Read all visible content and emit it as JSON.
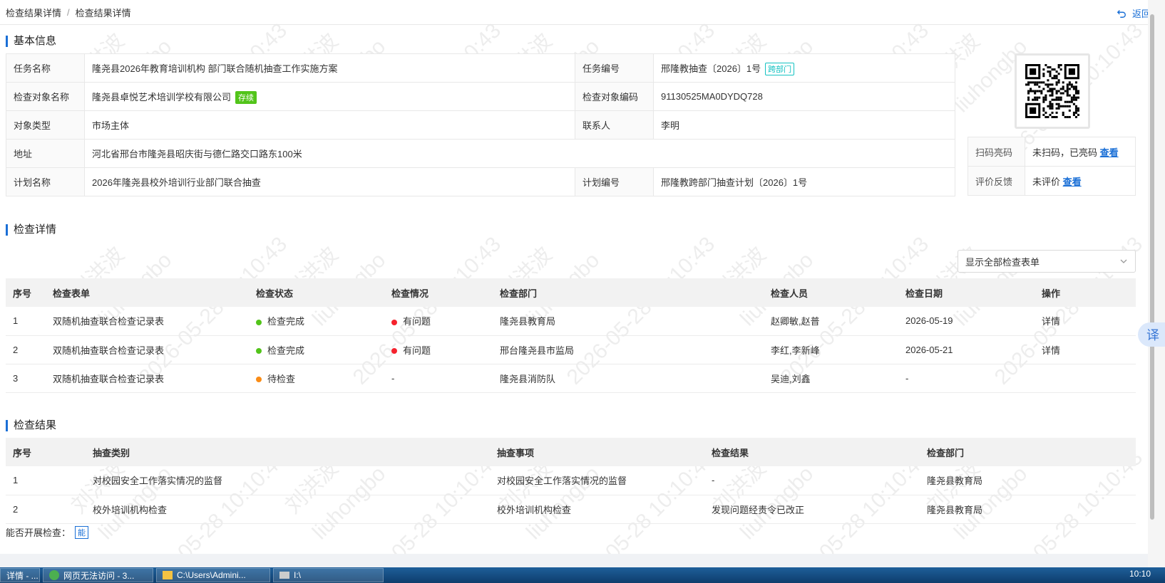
{
  "breadcrumb": {
    "items": [
      "检查结果详情",
      "检查结果详情"
    ],
    "separator": "/"
  },
  "back_label": "返回",
  "sections": {
    "basic": "基本信息",
    "detail": "检查详情",
    "result": "检查结果"
  },
  "basic_info": {
    "task_name_label": "任务名称",
    "task_name": "隆尧县2026年教育培训机构 部门联合随机抽查工作实施方案",
    "task_no_label": "任务编号",
    "task_no": "邢隆教抽查〔2026〕1号",
    "task_no_tag": "跨部门",
    "target_name_label": "检查对象名称",
    "target_name": "隆尧县卓悦艺术培训学校有限公司",
    "target_tag": "存续",
    "target_code_label": "检查对象编码",
    "target_code": "91130525MA0DYDQ728",
    "type_label": "对象类型",
    "type": "市场主体",
    "contact_label": "联系人",
    "contact": "李明",
    "address_label": "地址",
    "address": "河北省邢台市隆尧县昭庆街与德仁路交口路东100米",
    "plan_name_label": "计划名称",
    "plan_name": "2026年隆尧县校外培训行业部门联合抽查",
    "plan_no_label": "计划编号",
    "plan_no": "邢隆教跨部门抽查计划〔2026〕1号"
  },
  "side": {
    "scan_label": "扫码亮码",
    "scan_value": "未扫码，已亮码",
    "scan_link": "查看",
    "feedback_label": "评价反馈",
    "feedback_value": "未评价",
    "feedback_link": "查看"
  },
  "filter_select": "显示全部检查表单",
  "detail_table": {
    "headers": [
      "序号",
      "检查表单",
      "检查状态",
      "检查情况",
      "检查部门",
      "检查人员",
      "检查日期",
      "操作"
    ],
    "rows": [
      {
        "no": "1",
        "form": "双随机抽查联合检查记录表",
        "status": "检查完成",
        "situation": "有问题",
        "dept": "隆尧县教育局",
        "staff": "赵卿敏,赵普",
        "date": "2026-05-19",
        "action": "详情"
      },
      {
        "no": "2",
        "form": "双随机抽查联合检查记录表",
        "status": "检查完成",
        "situation": "有问题",
        "dept": "邢台隆尧县市监局",
        "staff": "李红,李新峰",
        "date": "2026-05-21",
        "action": "详情"
      },
      {
        "no": "3",
        "form": "双随机抽查联合检查记录表",
        "status": "待检查",
        "situation": "-",
        "dept": "隆尧县消防队",
        "staff": "吴迪,刘鑫",
        "date": "-",
        "action": ""
      }
    ]
  },
  "result_table": {
    "headers": [
      "序号",
      "抽查类别",
      "抽查事项",
      "检查结果",
      "检查部门"
    ],
    "rows": [
      {
        "no": "1",
        "category": "对校园安全工作落实情况的监督",
        "item": "对校园安全工作落实情况的监督",
        "result": "-",
        "dept": "隆尧县教育局"
      },
      {
        "no": "2",
        "category": "校外培训机构检查",
        "item": "校外培训机构检查",
        "result": "发现问题经责令已改正",
        "dept": "隆尧县教育局"
      }
    ]
  },
  "can_check_label": "能否开展检查：",
  "can_check_value": "能",
  "translate_label": "译",
  "watermark": {
    "name": "刘洪波",
    "user": "liuhongbo",
    "time": "2026-05-28 10:10:43"
  },
  "taskbar": {
    "items": [
      "详情 - ...",
      "网页无法访问 - 3...",
      "C:\\Users\\Admini...",
      "I:\\"
    ],
    "clock": "10:10"
  },
  "colors": {
    "accent": "#1a6fd6",
    "success": "#52c41a",
    "danger": "#f5222d",
    "warning": "#fa8c16"
  }
}
